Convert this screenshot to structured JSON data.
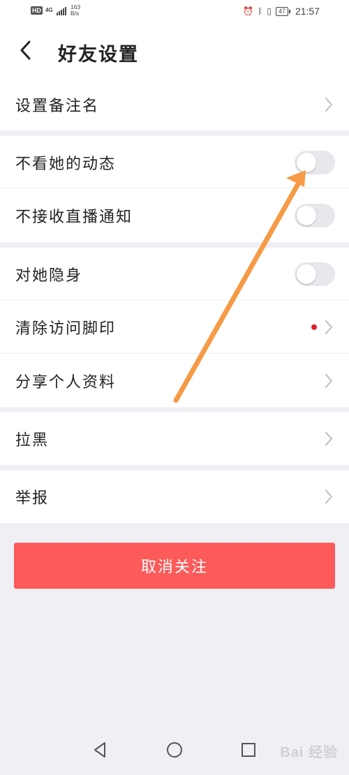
{
  "status_bar": {
    "hd": "HD",
    "network_type": "4G",
    "net_speed_value": "163",
    "net_speed_unit": "B/s",
    "battery": "47",
    "time": "21:57"
  },
  "header": {
    "title": "好友设置"
  },
  "settings": {
    "remark_name": "设置备注名",
    "hide_her_moments": "不看她的动态",
    "hide_her_moments_enabled": false,
    "no_live_notifications": "不接收直播通知",
    "no_live_notifications_enabled": false,
    "invisible_to_her": "对她隐身",
    "invisible_to_her_enabled": false,
    "clear_footprints": "清除访问脚印",
    "clear_footprints_has_badge": true,
    "share_profile": "分享个人资料",
    "block": "拉黑",
    "report": "举报"
  },
  "actions": {
    "unfollow_label": "取消关注"
  },
  "colors": {
    "accent_red": "#fd5a5a",
    "badge_red": "#e0202a",
    "annotation_arrow": "#f79a45"
  },
  "watermark": {
    "text": "Bai 经验"
  },
  "icons": {
    "back": "back-arrow-icon",
    "chevron": "chevron-right-icon",
    "nav_back": "triangle-back-icon",
    "nav_home": "circle-home-icon",
    "nav_recent": "square-recent-icon"
  }
}
